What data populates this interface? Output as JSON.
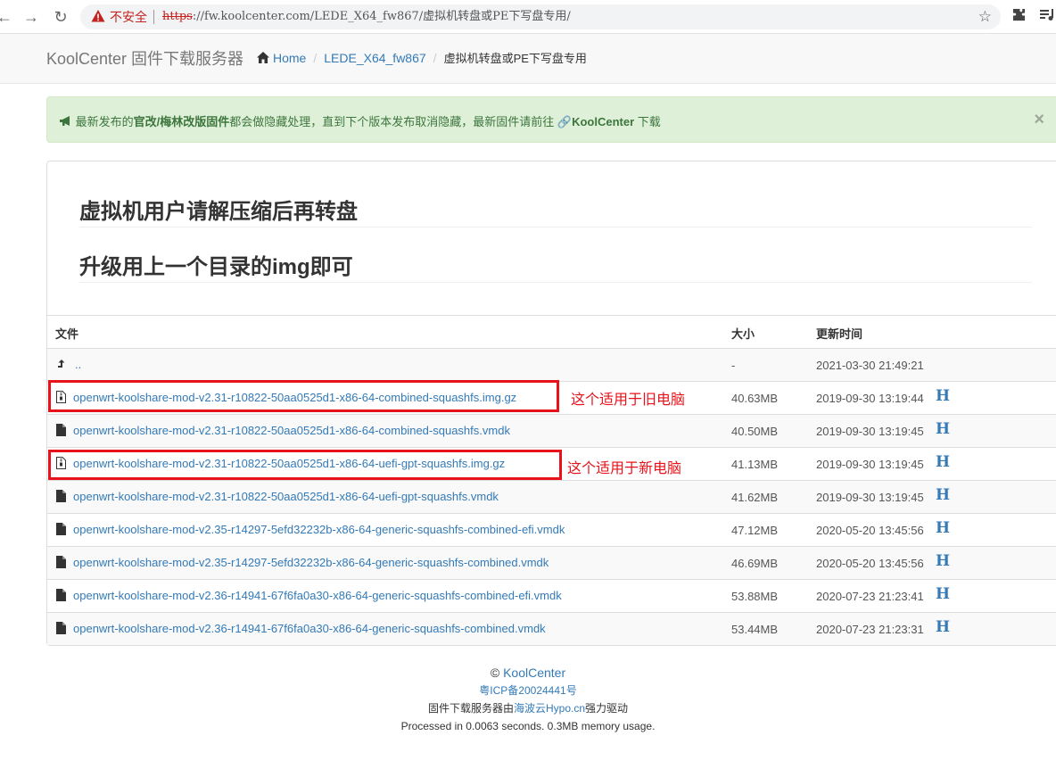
{
  "browser": {
    "insecure_label": "不安全",
    "url_scheme": "https",
    "url_rest": "://fw.koolcenter.com/LEDE_X64_fw867/虚拟机转盘或PE下写盘专用/"
  },
  "header": {
    "brand": "KoolCenter 固件下载服务器",
    "breadcrumb": [
      {
        "label": "Home"
      },
      {
        "label": "LEDE_X64_fw867"
      },
      {
        "label": "虚拟机转盘或PE下写盘专用"
      }
    ]
  },
  "alert": {
    "prefix": "最新发布的",
    "bold1": "官改/梅林改版固件",
    "middle": "都会做隐藏处理，直到下个版本发布取消隐藏，最新固件请前往",
    "bold2": "KoolCenter",
    "suffix": "下载",
    "close": "×"
  },
  "readme": {
    "heading1": "虚拟机用户请解压缩后再转盘",
    "heading2": "升级用上一个目录的img即可"
  },
  "table": {
    "headers": {
      "file": "文件",
      "size": "大小",
      "time": "更新时间"
    },
    "parent": {
      "name": "..",
      "size": "-",
      "time": "2021-03-30 21:49:21"
    },
    "rows": [
      {
        "name": "openwrt-koolshare-mod-v2.31-r10822-50aa0525d1-x86-64-combined-squashfs.img.gz",
        "size": "40.63MB",
        "time": "2019-09-30 13:19:44",
        "hash": "H"
      },
      {
        "name": "openwrt-koolshare-mod-v2.31-r10822-50aa0525d1-x86-64-combined-squashfs.vmdk",
        "size": "40.50MB",
        "time": "2019-09-30 13:19:45",
        "hash": "H"
      },
      {
        "name": "openwrt-koolshare-mod-v2.31-r10822-50aa0525d1-x86-64-uefi-gpt-squashfs.img.gz",
        "size": "41.13MB",
        "time": "2019-09-30 13:19:45",
        "hash": "H"
      },
      {
        "name": "openwrt-koolshare-mod-v2.31-r10822-50aa0525d1-x86-64-uefi-gpt-squashfs.vmdk",
        "size": "41.62MB",
        "time": "2019-09-30 13:19:45",
        "hash": "H"
      },
      {
        "name": "openwrt-koolshare-mod-v2.35-r14297-5efd32232b-x86-64-generic-squashfs-combined-efi.vmdk",
        "size": "47.12MB",
        "time": "2020-05-20 13:45:56",
        "hash": "H"
      },
      {
        "name": "openwrt-koolshare-mod-v2.35-r14297-5efd32232b-x86-64-generic-squashfs-combined.vmdk",
        "size": "46.69MB",
        "time": "2020-05-20 13:45:56",
        "hash": "H"
      },
      {
        "name": "openwrt-koolshare-mod-v2.36-r14941-67f6fa0a30-x86-64-generic-squashfs-combined-efi.vmdk",
        "size": "53.88MB",
        "time": "2020-07-23 21:23:41",
        "hash": "H"
      },
      {
        "name": "openwrt-koolshare-mod-v2.36-r14941-67f6fa0a30-x86-64-generic-squashfs-combined.vmdk",
        "size": "53.44MB",
        "time": "2020-07-23 21:23:31",
        "hash": "H"
      }
    ]
  },
  "annotations": {
    "old_pc": "这个适用于旧电脑",
    "new_pc": "这个适用于新电脑"
  },
  "footer": {
    "copyright_symbol": "©",
    "copyright_link": "KoolCenter",
    "icp": "粤ICP备20024441号",
    "powered_prefix": "固件下载服务器由",
    "powered_link": "海波云Hypo.cn",
    "powered_suffix": "强力驱动",
    "stats": "Processed in 0.0063 seconds. 0.3MB memory usage."
  },
  "colors": {
    "link": "#337ab7",
    "annotation": "#e8121b",
    "alert_bg": "#dff0d8",
    "alert_text": "#3c763d"
  }
}
